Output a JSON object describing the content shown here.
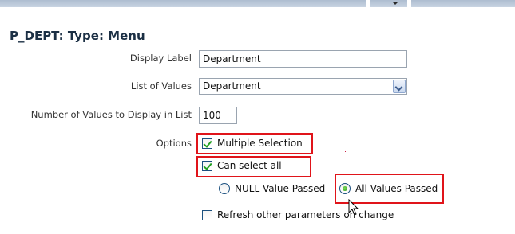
{
  "section_title": "P_DEPT: Type: Menu",
  "display_label": {
    "label": "Display Label",
    "value": "Department"
  },
  "list_of_values": {
    "label": "List of Values",
    "selected": "Department"
  },
  "num_values": {
    "label": "Number of Values to Display in List",
    "value": "100"
  },
  "options": {
    "label": "Options",
    "multiple_selection": {
      "label": "Multiple Selection",
      "checked": true
    },
    "can_select_all": {
      "label": "Can select all",
      "checked": true
    },
    "null_value_passed": {
      "label": "NULL Value Passed",
      "selected": false
    },
    "all_values_passed": {
      "label": "All Values Passed",
      "selected": true
    },
    "refresh_other_params": {
      "label": "Refresh other parameters on change",
      "checked": false
    }
  },
  "colors": {
    "highlight": "#e0141a",
    "title": "#1b2f44",
    "top_bar": "#aebdd0"
  },
  "icons": [
    "dropdown-arrow-icon",
    "checkmark-icon",
    "radio-dot-icon",
    "mouse-pointer-icon"
  ]
}
